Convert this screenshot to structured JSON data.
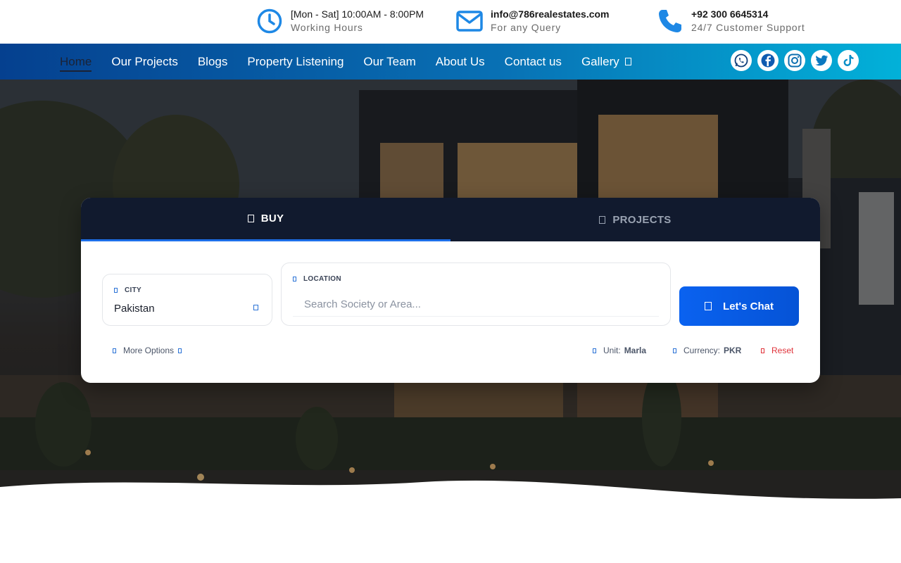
{
  "topbar": {
    "hours": {
      "line1": "[Mon - Sat] 10:00AM - 8:00PM",
      "line2": "Working Hours",
      "icon": "clock-icon"
    },
    "email": {
      "line1": "info@786realestates.com",
      "line2": "For any Query",
      "icon": "mail-icon"
    },
    "phone": {
      "line1": "+92 300 6645314",
      "line2": "24/7 Customer Support",
      "icon": "phone-icon"
    },
    "accent": "#1e88e5"
  },
  "nav": {
    "items": [
      {
        "label": "Home",
        "active": true
      },
      {
        "label": "Our Projects"
      },
      {
        "label": "Blogs"
      },
      {
        "label": "Property Listening"
      },
      {
        "label": "Our Team"
      },
      {
        "label": "About Us"
      },
      {
        "label": "Contact us"
      },
      {
        "label": "Gallery",
        "has_dropdown": true
      }
    ],
    "socials": [
      "whatsapp-icon",
      "facebook-icon",
      "instagram-icon",
      "twitter-icon",
      "tiktok-icon"
    ],
    "gradient": [
      "#05408f",
      "#02b1d9"
    ]
  },
  "search": {
    "tabs": [
      {
        "label": "BUY",
        "active": true
      },
      {
        "label": "PROJECTS",
        "active": false
      }
    ],
    "city": {
      "label": "CITY",
      "value": "Pakistan"
    },
    "location": {
      "label": "LOCATION",
      "placeholder": "Search Society or Area..."
    },
    "chat_button": "Let's Chat",
    "more_options": "More Options",
    "unit": {
      "label": "Unit:",
      "value": "Marla"
    },
    "currency": {
      "label": "Currency:",
      "value": "PKR"
    },
    "reset": "Reset",
    "accent": "#0a62f0",
    "reset_color": "#e0323a"
  }
}
